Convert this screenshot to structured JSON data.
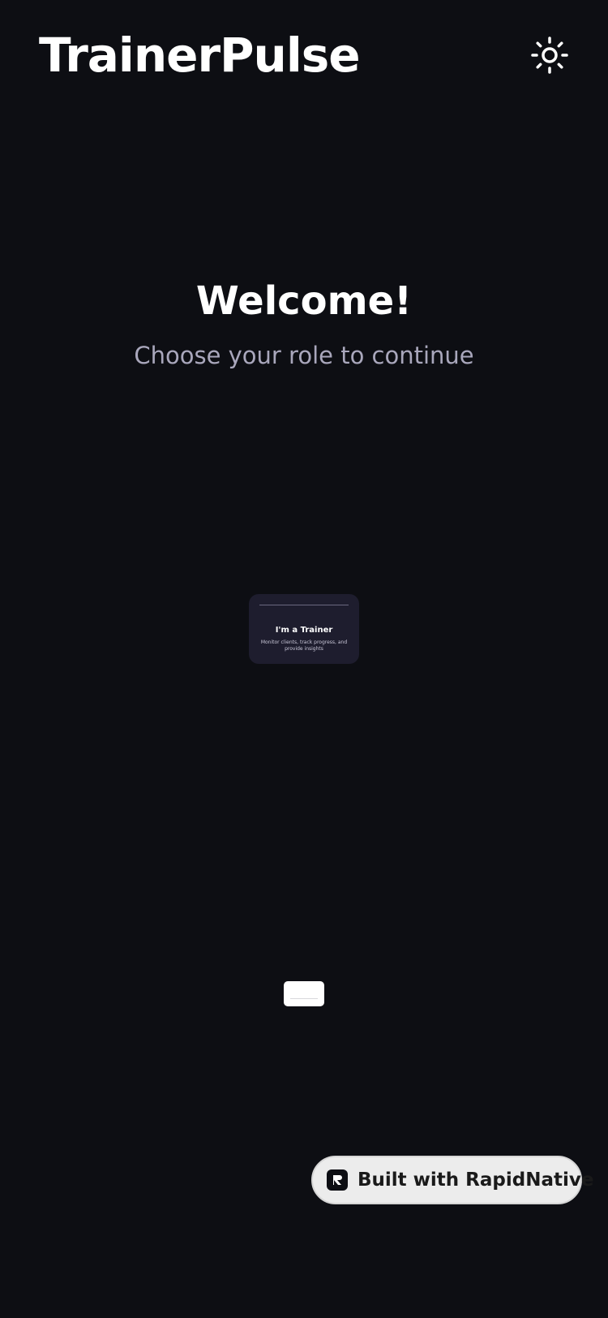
{
  "header": {
    "app_title": "TrainerPulse",
    "theme_icon": "sun-icon"
  },
  "main": {
    "welcome": "Welcome!",
    "subtitle": "Choose your role to continue"
  },
  "role_cards": [
    {
      "title": "I'm a Trainer",
      "description": "Monitor clients, track progress, and provide insights"
    }
  ],
  "badge": {
    "label": "Built with RapidNative",
    "icon": "rapidnative-logo-icon"
  },
  "colors": {
    "background": "#0d0e13",
    "card": "#1e1d2e",
    "subtitle": "#a9a7bc",
    "badge_bg": "#ececec"
  }
}
